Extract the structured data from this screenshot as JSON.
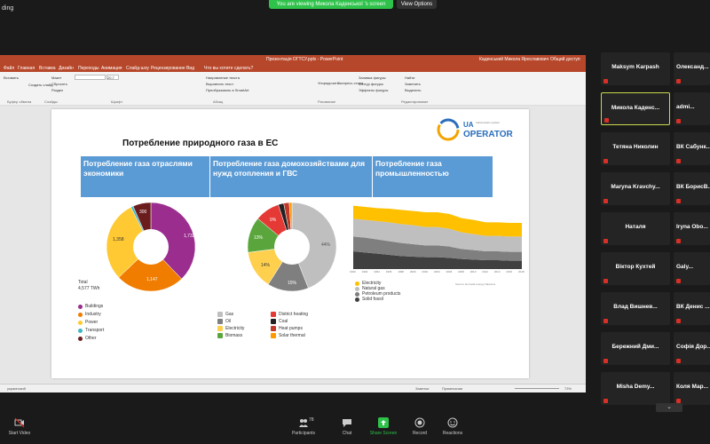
{
  "zoom": {
    "recording_label": "ding",
    "viewing_banner": "You are viewing Микола Каденської 's screen",
    "view_options": "View Options",
    "toolbar": {
      "start_video": "Start Video",
      "participants": "Participants",
      "participants_count": "78",
      "chat": "Chat",
      "share_screen": "Share Screen",
      "record": "Record",
      "reactions": "Reactions"
    },
    "accent_share": "#2ec24a",
    "mic_muted_color": "#d93025"
  },
  "ppt": {
    "title": "Презентація ОГТСУ.pptx - PowerPoint",
    "user": "Каденський Микола Ярославович",
    "share": "Общий доступ",
    "tabs": [
      "Файл",
      "Главная",
      "Вставка",
      "Дизайн",
      "Переходы",
      "Анимация",
      "Слайд-шоу",
      "Рецензирование",
      "Вид"
    ],
    "search_hint": "Что вы хотите сделать?",
    "ribbon": {
      "groups": [
        "Буфер обмена",
        "Слайды",
        "Шрифт",
        "Абзац",
        "Рисование",
        "Редактирование"
      ],
      "buttons": [
        "Вставить",
        "Создать слайд",
        "Макет",
        "Сбросить",
        "Раздел",
        "Упорядочить",
        "Экспресс-стили",
        "Найти",
        "Заменить",
        "Выделить"
      ],
      "font_size": "20,7",
      "para_items": [
        "Направление текста",
        "Выровнять текст",
        "Преобразовать в SmartArt"
      ],
      "draw_items": [
        "Заливка фигуры",
        "Контур фигуры",
        "Эффекты фигуры"
      ]
    },
    "status": {
      "left": "украинский",
      "notes": "Заметки",
      "comments": "Примечания",
      "zoom": "73%"
    }
  },
  "slide": {
    "title": "Потребление природного газа в ЕС",
    "logo": {
      "top": "UA",
      "bottom": "OPERATOR",
      "small": "transmission system"
    },
    "headers": [
      "Потребление газа отраслями экономики",
      "Потребление газа домохозяйствами для нужд отопления и ГВС",
      "Потребление газа промышленностью"
    ],
    "total_label": "Total",
    "total_value": "4,577 TWh",
    "legend1": [
      {
        "label": "Buildings",
        "color": "#9b2d8e"
      },
      {
        "label": "Industry",
        "color": "#f07c00"
      },
      {
        "label": "Power",
        "color": "#ffc933"
      },
      {
        "label": "Transport",
        "color": "#41b6c4"
      },
      {
        "label": "Other",
        "color": "#6b1d1d"
      }
    ],
    "legend2": [
      {
        "label": "Gas",
        "color": "#bfbfbf"
      },
      {
        "label": "District heating",
        "color": "#e53935"
      },
      {
        "label": "Oil",
        "color": "#7f7f7f"
      },
      {
        "label": "Coal",
        "color": "#222222"
      },
      {
        "label": "Electricity",
        "color": "#ffd04d"
      },
      {
        "label": "Heat pumps",
        "color": "#c0392b"
      },
      {
        "label": "Biomass",
        "color": "#5aa63c"
      },
      {
        "label": "Solar thermal",
        "color": "#ff9900"
      }
    ],
    "legend3": [
      {
        "label": "Electricity",
        "color": "#ffc000"
      },
      {
        "label": "Natural gas",
        "color": "#bfbfbf"
      },
      {
        "label": "Petroleum products",
        "color": "#7f7f7f"
      },
      {
        "label": "Solid fossil",
        "color": "#404040"
      }
    ],
    "source_note": "Source: Eurostat energy balances",
    "donut1": {
      "labels": [
        "1,732",
        "1,147",
        "1,358",
        "300"
      ]
    },
    "donut2": {
      "labels": [
        "44%",
        "15%",
        "14%",
        "13%",
        "9%"
      ]
    },
    "area_years": [
      "1990",
      "1992",
      "1994",
      "1996",
      "1998",
      "2000",
      "2002",
      "2004",
      "2006",
      "2008",
      "2010",
      "2012",
      "2014",
      "2016",
      "2018"
    ]
  },
  "chart_data": [
    {
      "type": "pie",
      "title": "Потребление газа отраслями экономики",
      "categories": [
        "Buildings",
        "Industry",
        "Power",
        "Transport",
        "Other"
      ],
      "values": [
        1732,
        1147,
        1358,
        40,
        300
      ]
    },
    {
      "type": "pie",
      "title": "Потребление газа домохозяйствами для нужд отопления и ГВС",
      "categories": [
        "Gas",
        "Oil",
        "Electricity",
        "Biomass",
        "District heating",
        "Coal",
        "Heat pumps",
        "Solar thermal"
      ],
      "values": [
        44,
        15,
        14,
        13,
        9,
        2,
        2,
        1
      ]
    },
    {
      "type": "area",
      "title": "Потребление газа промышленностью",
      "x": [
        "1990",
        "1992",
        "1994",
        "1996",
        "1998",
        "2000",
        "2002",
        "2004",
        "2006",
        "2008",
        "2010",
        "2012",
        "2014",
        "2016",
        "2018"
      ],
      "series": [
        {
          "name": "Solid fossil",
          "values": [
            30,
            28,
            26,
            24,
            22,
            21,
            20,
            20,
            19,
            17,
            16,
            15,
            15,
            14,
            14
          ]
        },
        {
          "name": "Petroleum products",
          "values": [
            25,
            25,
            24,
            23,
            22,
            21,
            20,
            20,
            19,
            17,
            16,
            15,
            15,
            15,
            15
          ]
        },
        {
          "name": "Natural gas",
          "values": [
            30,
            30,
            31,
            32,
            32,
            32,
            31,
            31,
            30,
            28,
            27,
            26,
            26,
            26,
            26
          ]
        },
        {
          "name": "Electricity",
          "values": [
            22,
            22,
            22,
            23,
            24,
            24,
            25,
            25,
            25,
            24,
            24,
            23,
            23,
            23,
            23
          ]
        }
      ]
    }
  ],
  "participants": {
    "left": [
      "Maksym Karpash",
      "Микола Каденс...",
      "Тетяна Николин",
      "Maryna Kravchy...",
      "Наталя",
      "Віктор Кухтей",
      "Влад Вишнев...",
      "Бережний Дми...",
      "Misha Demy..."
    ],
    "right": [
      "Олександ...",
      "admi...",
      "ВК Сабунк...",
      "ВК БорисВ...",
      "Iryna Obo...",
      "Galy...",
      "ВК Денис ...",
      "Софія Дор...",
      "Коля Мар..."
    ]
  }
}
